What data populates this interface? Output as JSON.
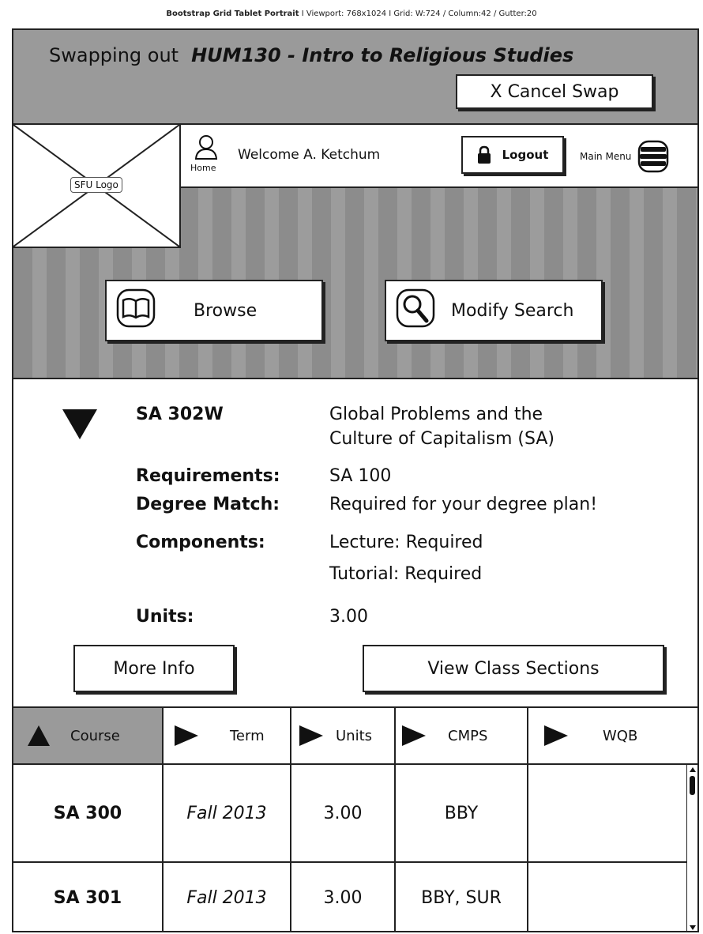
{
  "caption": {
    "title": "Bootstrap Grid Tablet Portrait",
    "details": " I  Viewport: 768x1024  I  Grid: W:724 / Column:42 / Gutter:20"
  },
  "swap": {
    "prefix": "Swapping out",
    "course": "HUM130 - Intro to Religious Studies",
    "cancel_label": "X Cancel Swap"
  },
  "header": {
    "logo_label": "SFU Logo",
    "home_label": "Home",
    "welcome": "Welcome A. Ketchum",
    "logout_label": "Logout",
    "menu_label": "Main Menu"
  },
  "actions": {
    "browse_label": "Browse",
    "search_label": "Modify Search"
  },
  "course_detail": {
    "code": "SA 302W",
    "title_line1": "Global Problems and the",
    "title_line2": "Culture of Capitalism (SA)",
    "requirements_label": "Requirements:",
    "requirements_value": "SA 100",
    "degree_label": "Degree Match:",
    "degree_value": "Required for your degree plan!",
    "components_label": "Components:",
    "component1": "Lecture: Required",
    "component2": "Tutorial: Required",
    "units_label": "Units:",
    "units_value": "3.00",
    "more_info_label": "More Info",
    "sections_label": "View Class Sections"
  },
  "table": {
    "headers": [
      "Course",
      "Term",
      "Units",
      "CMPS",
      "WQB"
    ],
    "rows": [
      {
        "course": "SA 300",
        "term": "Fall 2013",
        "units": "3.00",
        "cmps": "BBY",
        "wqb": ""
      },
      {
        "course": "SA 301",
        "term": "Fall 2013",
        "units": "3.00",
        "cmps": "BBY, SUR",
        "wqb": ""
      }
    ]
  }
}
